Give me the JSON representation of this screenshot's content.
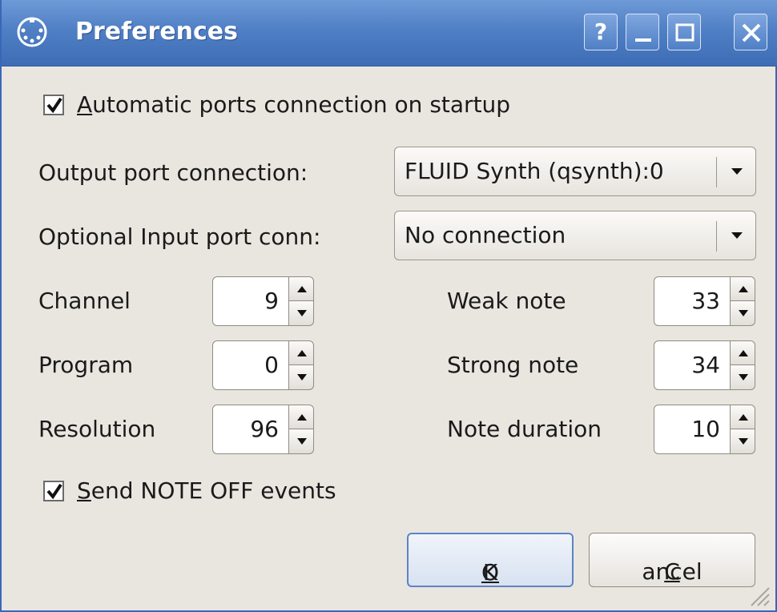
{
  "window": {
    "title": "Preferences",
    "icons": {
      "app": "midi-connector-icon",
      "help": "help-icon",
      "minimize": "minimize-icon",
      "maximize": "maximize-icon",
      "close": "close-icon"
    },
    "help_glyph": "?"
  },
  "auto_connect": {
    "label_mnemonic": "A",
    "label_rest": "utomatic ports connection on startup",
    "checked": true
  },
  "output_port": {
    "label": "Output port connection:",
    "value": "FLUID Synth (qsynth):0"
  },
  "input_port": {
    "label": "Optional Input port conn:",
    "value": "No connection"
  },
  "channel": {
    "label": "Channel",
    "value": "9"
  },
  "program": {
    "label": "Program",
    "value": "0"
  },
  "resolution": {
    "label": "Resolution",
    "value": "96"
  },
  "weak_note": {
    "label": "Weak note",
    "value": "33"
  },
  "strong_note": {
    "label": "Strong note",
    "value": "34"
  },
  "note_duration": {
    "label": "Note duration",
    "value": "10"
  },
  "note_off": {
    "label_mnemonic": "S",
    "label_rest": "end NOTE OFF events",
    "checked": true
  },
  "buttons": {
    "ok_mnemonic": "O",
    "ok_rest": "K",
    "cancel_mnemonic": "C",
    "cancel_rest": "ancel"
  },
  "colors": {
    "titlebar": "#4f7fc5",
    "window_bg": "#e9e6e0",
    "default_button_border": "#5c84c4"
  }
}
